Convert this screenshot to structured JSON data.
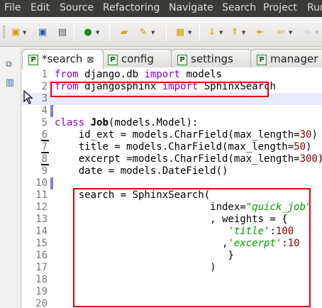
{
  "menu": [
    "File",
    "Edit",
    "Source",
    "Refactoring",
    "Navigate",
    "Search",
    "Project",
    "Run"
  ],
  "toolbar_icons": [
    "new-wizard-icon",
    "save-icon",
    "print-icon",
    "run-icon",
    "open-folder-icon",
    "edit-icon",
    "debug-icon",
    "next-annotation-icon",
    "previous-annotation-icon",
    "last-edit-icon",
    "back-icon",
    "forward-icon"
  ],
  "tabs": [
    {
      "label": "*search",
      "active": true,
      "closable": true
    },
    {
      "label": "config",
      "active": false
    },
    {
      "label": "settings",
      "active": false
    },
    {
      "label": "manager",
      "active": false
    }
  ],
  "editor": {
    "current_line": 3,
    "lines": [
      {
        "n": "1",
        "tokens": [
          {
            "t": "from",
            "c": "kw"
          },
          {
            "t": " django.db "
          },
          {
            "t": "import",
            "c": "kw"
          },
          {
            "t": " models"
          }
        ]
      },
      {
        "n": "2",
        "tokens": [
          {
            "t": "from",
            "c": "kw"
          },
          {
            "t": " djangosphinx "
          },
          {
            "t": "import",
            "c": "kw"
          },
          {
            "t": " SphinxSearch"
          }
        ]
      },
      {
        "n": "3",
        "tokens": []
      },
      {
        "n": "4",
        "tokens": []
      },
      {
        "n": "5",
        "tokens": [
          {
            "t": "class",
            "c": "kw"
          },
          {
            "t": " "
          },
          {
            "t": "Job",
            "c": "cls"
          },
          {
            "t": "(models.Model):"
          }
        ]
      },
      {
        "n": "6",
        "tokens": [
          {
            "t": "    id_ext = models.CharField(max_length="
          },
          {
            "t": "30",
            "c": "num"
          },
          {
            "t": ")"
          }
        ]
      },
      {
        "n": "7",
        "tokens": [
          {
            "t": "    title = models.CharField(max_length="
          },
          {
            "t": "50",
            "c": "num"
          },
          {
            "t": ")"
          }
        ]
      },
      {
        "n": "8",
        "tokens": [
          {
            "t": "    excerpt =models.CharField(max_length="
          },
          {
            "t": "300",
            "c": "num"
          },
          {
            "t": ")"
          }
        ]
      },
      {
        "n": "9",
        "tokens": [
          {
            "t": "    date = models.DateField()"
          }
        ]
      },
      {
        "n": "10",
        "tokens": []
      },
      {
        "n": "11",
        "tokens": [
          {
            "t": "    search = SphinxSearch("
          }
        ]
      },
      {
        "n": "12",
        "tokens": [
          {
            "t": "                          index="
          },
          {
            "t": "\"quick_job\"",
            "c": "str"
          }
        ]
      },
      {
        "n": "13",
        "tokens": [
          {
            "t": "                          , weights = {"
          }
        ]
      },
      {
        "n": "14",
        "tokens": [
          {
            "t": "                             "
          },
          {
            "t": "'title'",
            "c": "str"
          },
          {
            "t": ":"
          },
          {
            "t": "100",
            "c": "num"
          }
        ]
      },
      {
        "n": "15",
        "tokens": [
          {
            "t": "                            ,"
          },
          {
            "t": "'excerpt'",
            "c": "str"
          },
          {
            "t": ":"
          },
          {
            "t": "10",
            "c": "num"
          }
        ]
      },
      {
        "n": "16",
        "tokens": [
          {
            "t": "                             }"
          }
        ]
      },
      {
        "n": "17",
        "tokens": [
          {
            "t": "                          )"
          }
        ]
      },
      {
        "n": "18",
        "tokens": []
      },
      {
        "n": "19",
        "tokens": []
      },
      {
        "n": "20",
        "tokens": []
      }
    ]
  },
  "colors": {
    "highlight_box": "#e0000a",
    "keyword": "#8a00d0",
    "string": "#00a000",
    "number": "#800000"
  }
}
